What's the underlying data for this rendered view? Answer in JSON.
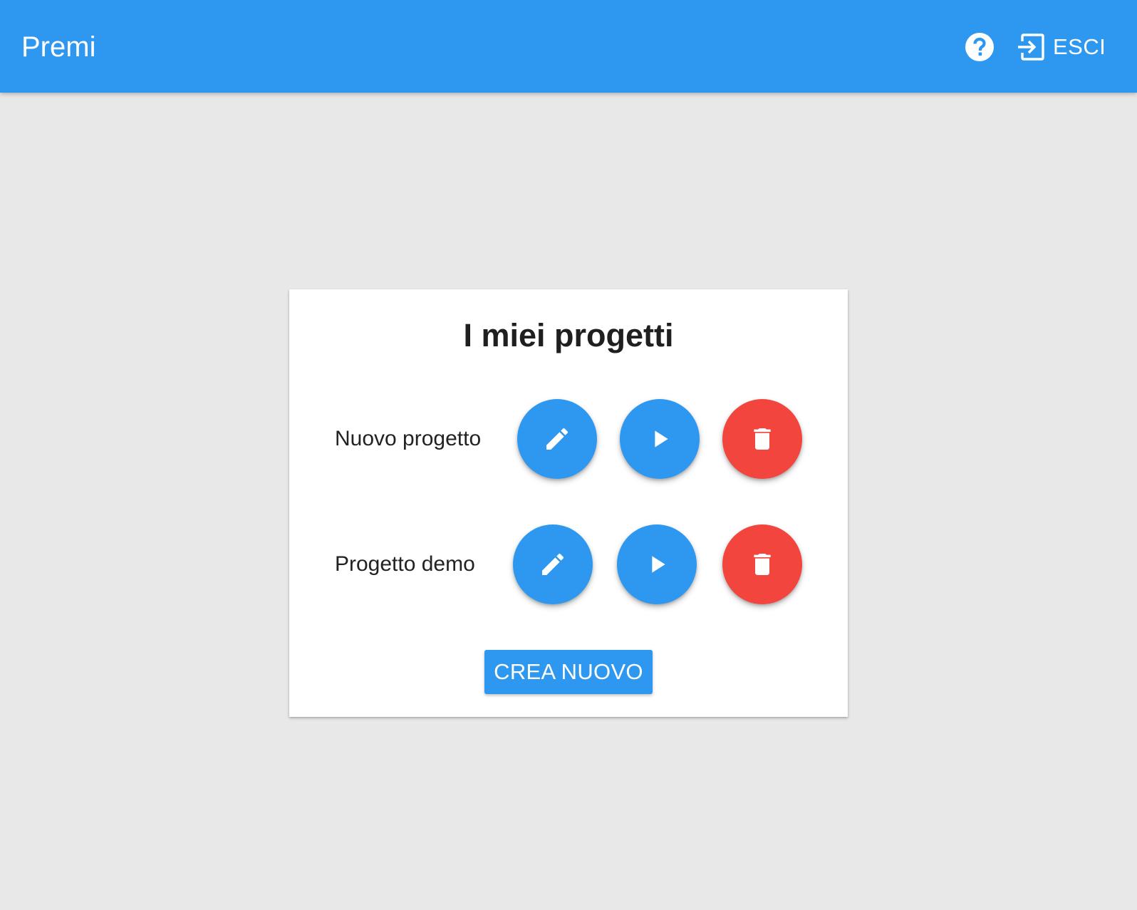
{
  "appbar": {
    "title": "Premi",
    "help_icon": "help-circle-icon",
    "exit_icon": "exit-to-app-icon",
    "exit_label": "ESCI",
    "color": "#2e98f0"
  },
  "card": {
    "title": "I miei progetti",
    "projects": [
      {
        "name": "Nuovo progetto"
      },
      {
        "name": "Progetto demo"
      }
    ],
    "action_icons": [
      "pencil-icon",
      "play-icon",
      "trash-icon"
    ],
    "create_label": "CREA NUOVO"
  },
  "colors": {
    "primary": "#2e98f0",
    "danger": "#f2453d",
    "background": "#e8e8e8"
  }
}
